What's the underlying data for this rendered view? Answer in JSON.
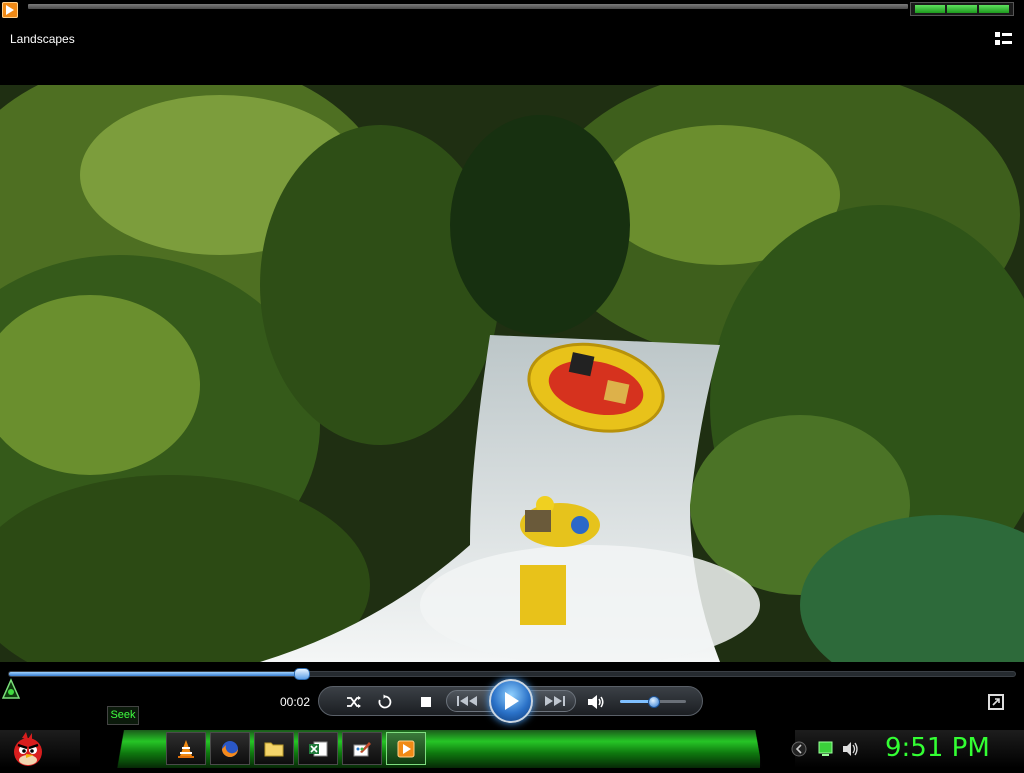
{
  "window": {
    "title": "Landscapes"
  },
  "player": {
    "elapsed": "00:02",
    "seek_progress": 0.29,
    "seek_tooltip": "Seek",
    "volume": 0.5
  },
  "taskbar": {
    "clock": "9:51 PM",
    "items": [
      {
        "name": "vlc",
        "icon": "vlc-cone-icon"
      },
      {
        "name": "firefox",
        "icon": "firefox-icon"
      },
      {
        "name": "file-explorer",
        "icon": "folder-icon"
      },
      {
        "name": "excel",
        "icon": "excel-icon"
      },
      {
        "name": "paint",
        "icon": "paint-icon"
      },
      {
        "name": "media-player",
        "icon": "media-player-icon"
      }
    ]
  },
  "colors": {
    "clock": "#33ff33",
    "accent_blue": "#2b72c8",
    "taskbar_green": "#26c526"
  }
}
